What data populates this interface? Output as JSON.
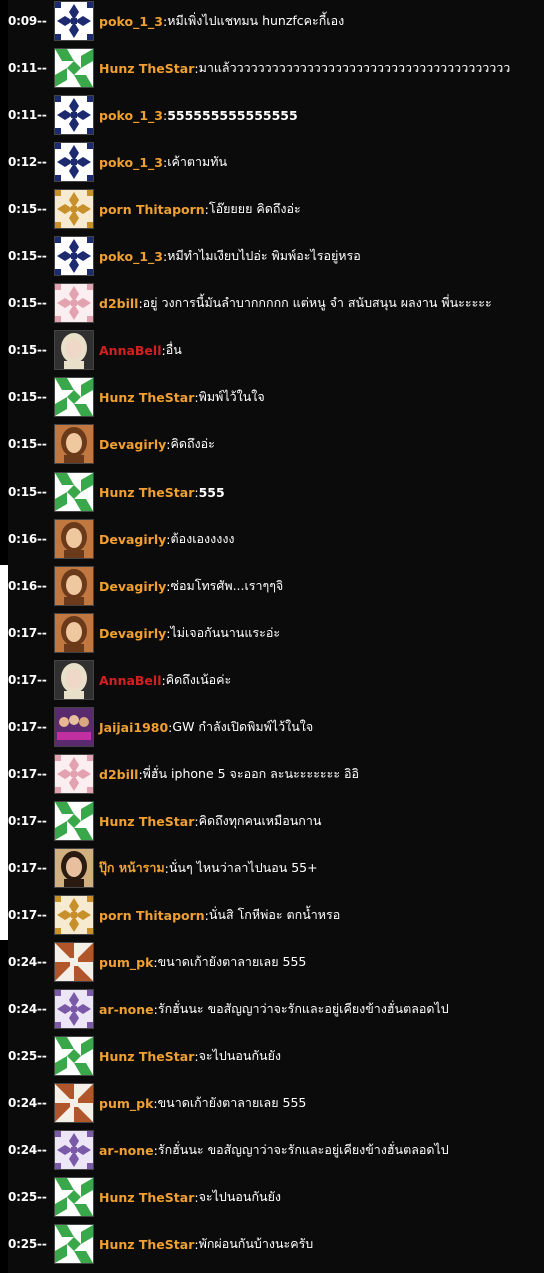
{
  "colors": {
    "name_default": "#f0a030",
    "name_red": "#d42020",
    "message": "#ffffff",
    "time": "#ffffff",
    "background": "#0b0b0c"
  },
  "messages": [
    {
      "time": "0:09--",
      "user": "poko_1_3",
      "avatar": "navy-quilt-avatar",
      "text": "หมีเพิ่งไปแชทมน hunzfcคะกี้เอง",
      "bold": false
    },
    {
      "time": "0:11--",
      "user": "Hunz TheStar",
      "avatar": "green-star-quilt-avatar",
      "text": "มาแล้วววววววววววววววววววววววววววววววววววววววว",
      "bold": false
    },
    {
      "time": "0:11--",
      "user": "poko_1_3",
      "avatar": "navy-quilt-avatar",
      "text": "555555555555555",
      "bold": true
    },
    {
      "time": "0:12--",
      "user": "poko_1_3",
      "avatar": "navy-quilt-avatar",
      "text": "เค้าตามทัน",
      "bold": false
    },
    {
      "time": "0:15--",
      "user": "porn Thitaporn",
      "avatar": "gold-diamond-quilt-avatar",
      "text": "โอ๊ยยยย คิดถึงอ่ะ",
      "bold": false
    },
    {
      "time": "0:15--",
      "user": "poko_1_3",
      "avatar": "navy-quilt-avatar",
      "text": "หมีทำไมเงียบไปอ่ะ พิมพ์อะไรอยู่หรอ",
      "bold": false
    },
    {
      "time": "0:15--",
      "user": "d2bill",
      "avatar": "pink-diamond-quilt-avatar",
      "text": "อยู่ วงการนี้มันลำบากกกกก แต่หนู จำ สนับสนุน ผลงาน พี่นะะะะะ",
      "bold": false
    },
    {
      "time": "0:15--",
      "user": "AnnaBell",
      "avatar": "blonde-girl-photo-avatar",
      "text": "อื่น",
      "bold": false,
      "red": true
    },
    {
      "time": "0:15--",
      "user": "Hunz TheStar",
      "avatar": "green-star-quilt-avatar",
      "text": "พิมพ์ไว้ในใจ",
      "bold": false
    },
    {
      "time": "0:15--",
      "user": "Devagirly",
      "avatar": "girl-photo-avatar",
      "text": "คิดถึงอ่ะ",
      "bold": false
    },
    {
      "time": "0:15--",
      "user": "Hunz TheStar",
      "avatar": "green-star-quilt-avatar",
      "text": "555",
      "bold": true
    },
    {
      "time": "0:16--",
      "user": "Devagirly",
      "avatar": "girl-photo-avatar",
      "text": "ต้องเองงงงง",
      "bold": false
    },
    {
      "time": "0:16--",
      "user": "Devagirly",
      "avatar": "girl-photo-avatar",
      "text": "ซ่อมโทรศัพ...เราๆๆจิ",
      "bold": false
    },
    {
      "time": "0:17--",
      "user": "Devagirly",
      "avatar": "girl-photo-avatar",
      "text": "ไม่เจอกันนานแระอ่ะ",
      "bold": false
    },
    {
      "time": "0:17--",
      "user": "AnnaBell",
      "avatar": "blonde-girl-photo-avatar",
      "text": "คิดถึงเน้อค่ะ",
      "bold": false,
      "red": true
    },
    {
      "time": "0:17--",
      "user": "Jaijai1980",
      "avatar": "group-photo-avatar",
      "text": "GW กำลังเปิดพิมพ์ไว้ในใจ",
      "bold": false
    },
    {
      "time": "0:17--",
      "user": "d2bill",
      "avatar": "pink-diamond-quilt-avatar",
      "text": "พี่ฮั่น iphone 5 จะออก ละนะะะะะะะ อิอิ",
      "bold": false
    },
    {
      "time": "0:17--",
      "user": "Hunz TheStar",
      "avatar": "green-star-quilt-avatar",
      "text": "คิดถึงทุกคนเหมือนกาน",
      "bold": false
    },
    {
      "time": "0:17--",
      "user": "ปุ๊ก หน้าราม",
      "avatar": "woman-photo-avatar",
      "text": "นั่นๆ ไหนว่าลาไปนอน 55+",
      "bold": false
    },
    {
      "time": "0:17--",
      "user": "porn Thitaporn",
      "avatar": "gold-diamond-quilt-avatar",
      "text": "นั่นสิ โกหีพ่อะ ตกน้ำหรอ",
      "bold": false
    },
    {
      "time": "0:24--",
      "user": "pum_pk",
      "avatar": "brown-pinwheel-quilt-avatar",
      "text": "ขนาดเก้ายังตาลายเลย 555",
      "bold": false
    },
    {
      "time": "0:24--",
      "user": "ar-none",
      "avatar": "purple-quilt-avatar",
      "text": "รักฮั่นนะ ขอสัญญาว่าจะรักและอยู่เคียงข้างฮั่นตลอดไป",
      "bold": false
    },
    {
      "time": "0:25--",
      "user": "Hunz TheStar",
      "avatar": "green-star-quilt-avatar",
      "text": "จะไปนอนกันยัง",
      "bold": false
    },
    {
      "time": "0:24--",
      "user": "pum_pk",
      "avatar": "brown-pinwheel-quilt-avatar",
      "text": "ขนาดเก้ายังตาลายเลย 555",
      "bold": false
    },
    {
      "time": "0:24--",
      "user": "ar-none",
      "avatar": "purple-quilt-avatar",
      "text": "รักฮั่นนะ ขอสัญญาว่าจะรักและอยู่เคียงข้างฮั่นตลอดไป",
      "bold": false
    },
    {
      "time": "0:25--",
      "user": "Hunz TheStar",
      "avatar": "green-star-quilt-avatar",
      "text": "จะไปนอนกันยัง",
      "bold": false
    },
    {
      "time": "0:25--",
      "user": "Hunz TheStar",
      "avatar": "green-star-quilt-avatar",
      "text": "พักผ่อนกันบ้างนะครับ",
      "bold": false
    }
  ]
}
